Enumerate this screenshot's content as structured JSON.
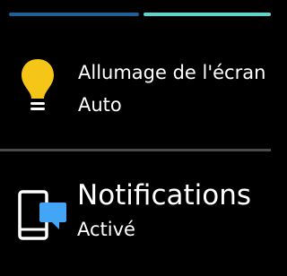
{
  "colors": {
    "background": "#000000",
    "page_indicator_inactive": "#1f5f96",
    "page_indicator_active": "#5fd6c9",
    "bulb": "#f5c518",
    "chat_bubble": "#43a5f5",
    "divider": "#4a4a4a"
  },
  "pager": {
    "page_count": 2,
    "active_page": 2
  },
  "settings": [
    {
      "icon": "lightbulb-icon",
      "title": "Allumage de l'écran",
      "value": "Auto"
    },
    {
      "icon": "phone-notification-icon",
      "title": "Notifications",
      "value": "Activé"
    }
  ]
}
